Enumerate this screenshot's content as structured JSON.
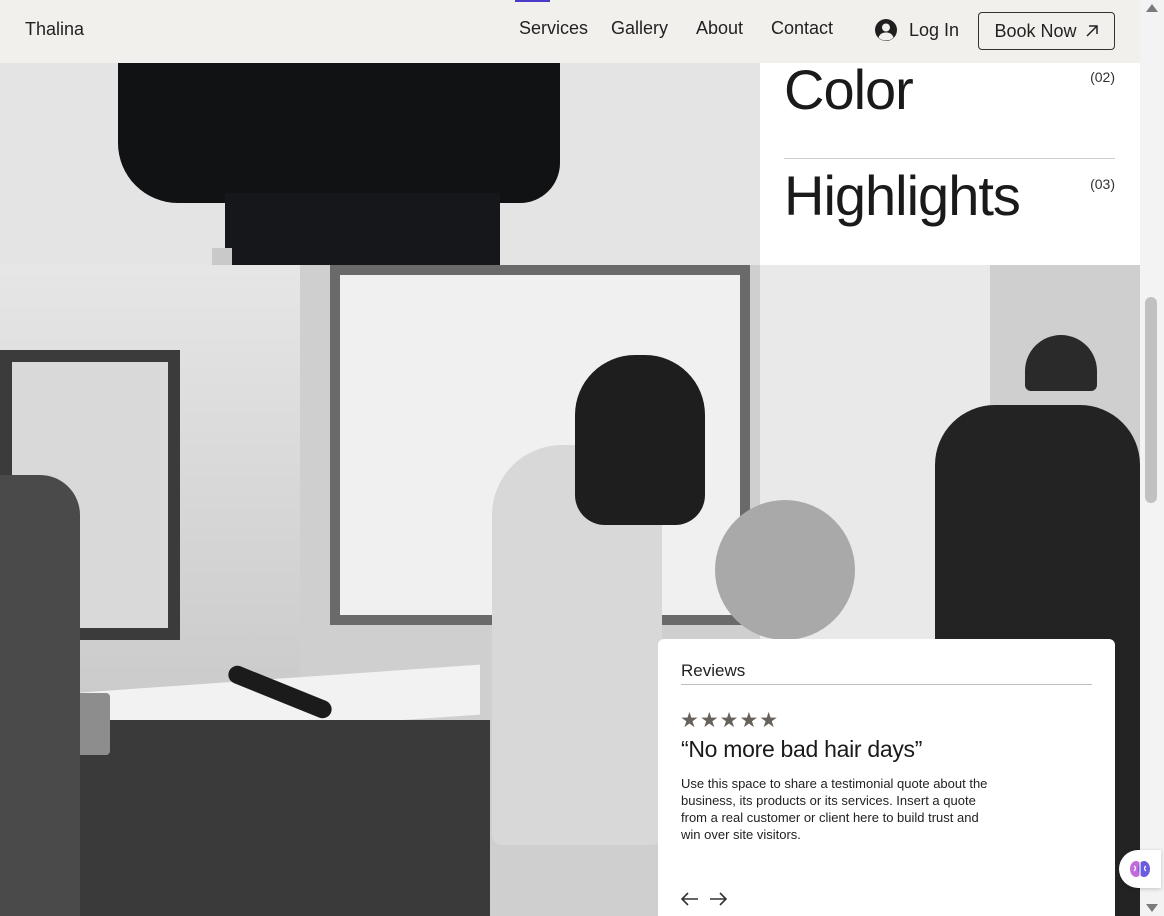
{
  "header": {
    "brand": "Thalina",
    "nav": [
      "Services",
      "Gallery",
      "About",
      "Contact"
    ],
    "login_label": "Log In",
    "book_label": "Book Now",
    "accent_color": "#4a3cc8",
    "background": "#f2f0ec"
  },
  "services": [
    {
      "name": "Color",
      "number": "(02)"
    },
    {
      "name": "Highlights",
      "number": "(03)"
    }
  ],
  "reviews": {
    "heading": "Reviews",
    "stars": "★★★★★",
    "rating": 5,
    "quote": "“No more bad hair days”",
    "body": "Use this space to share a testimonial quote about the business, its products or its services. Insert a quote from a real customer or client here to build trust and win over site visitors.",
    "prev_icon": "arrow-left-icon",
    "next_icon": "arrow-right-icon"
  },
  "icons": {
    "user": "user-circle-icon",
    "external": "arrow-up-right-icon",
    "widget": "brain-icon"
  }
}
